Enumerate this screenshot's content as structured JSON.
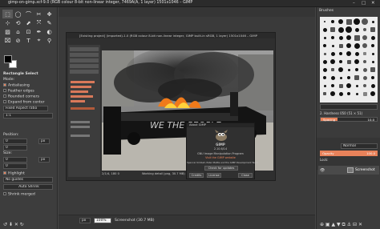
{
  "window": {
    "title": "gimp-on-gimp.xcf-9.0 (RGB colour 8-bit non-linear integer, 7469A(A, 1 layer) 1501x1046 – GIMP",
    "min": "–",
    "max": "□",
    "close": "✕"
  },
  "toolbox": {
    "tools": [
      "⬚",
      "◯",
      "⌒",
      "✂",
      "✥",
      "⊹",
      "⟲",
      "⬈",
      "⤧",
      "✎",
      "▨",
      "⌂",
      "⊡",
      "✒",
      "◐",
      "⌧",
      "⊘",
      "T",
      "⌖",
      "⚲"
    ],
    "fg_color": "#000000",
    "bg_color": "#ffffff",
    "options_title": "Rectangle Select",
    "mode_label": "Mode:",
    "antialiasing": "Antialiasing",
    "feather_edges": "Feather edges",
    "rounded_corners": "Rounded corners",
    "expand_from_center": "Expand from center",
    "fixed": "Fixed Aspect ratio",
    "ratio_value": "1:1",
    "position_label": "Position:",
    "position_unit": "px",
    "position_x": "0",
    "position_y": "0",
    "size_label": "Size:",
    "size_unit": "px",
    "size_w": "0",
    "size_h": "0",
    "highlight": "Highlight",
    "guides": "No guides",
    "auto_shrink": "Auto Shrink",
    "shrink_merged": "Shrink merged"
  },
  "image_window": {
    "title": "[Existing project] (imported)-1.0 (RGB colour 8-bit non-linear integer, GIMP built-in sRGB, 1 layer) 1501x1046 – GIMP",
    "status_left": "2/1/4, 180 0",
    "status_zoom": "px",
    "status_mid": "Working detail (png, 30.7 MB)",
    "status_right": "0.8 1.7 3.4 4"
  },
  "about": {
    "title": "About GIMP",
    "app_name": "GIMP",
    "version": "2.10.6/14",
    "program_desc": "GNU Image Manipulation Program",
    "website": "Visit the GIMP website",
    "copyright": "Spencer Kimball, Peter Mattis and the GIMP Development Team",
    "check_updates": "Check for updates",
    "credits": "Credits",
    "license": "License",
    "close": "Close"
  },
  "statusbar": {
    "unit": "px",
    "zoom": "100%",
    "info": "Screenshot (30.7 MB)"
  },
  "right_panel": {
    "tabs_title": "Brushes",
    "filter_placeholder": "",
    "brush_name": "2. Hardness 050 (51 × 51)",
    "spacing_label": "Spacing",
    "spacing_value": "10.0",
    "layers_mode": "Normal",
    "opacity_label": "Opacity",
    "opacity_value": "100.0",
    "lock_label": "Lock:",
    "layer_name": "Screenshot"
  },
  "colors": {
    "accent": "#e8825a",
    "selected": "#5a5a5a"
  }
}
